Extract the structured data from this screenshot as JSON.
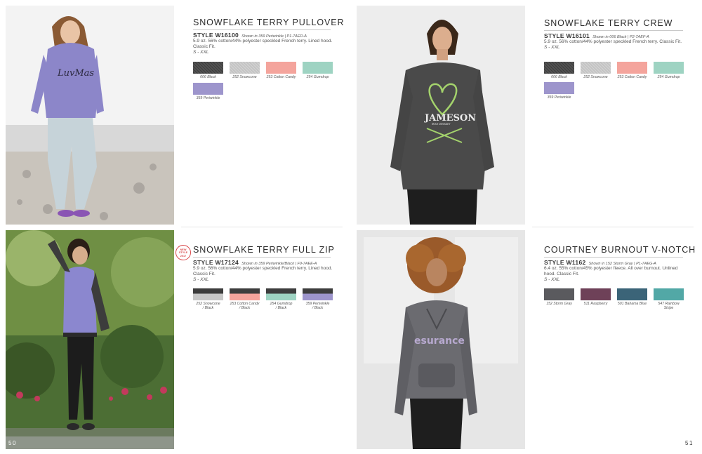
{
  "pages": {
    "left_number": "50",
    "right_number": "51"
  },
  "products": {
    "pullover": {
      "title": "SNOWFLAKE TERRY PULLOVER",
      "style_code": "STYLE W16100",
      "style_note": "Shown in 359 Periwinkle | P1-7AED-A",
      "description": "5.9 oz. 56% cotton/44% polyester speckled French terry. Lined hood. Classic Fit.",
      "sizes": "S - XXL",
      "swatches": [
        {
          "label": "006 Black",
          "color": "#4a4a4a"
        },
        {
          "label": "252 Snowcone",
          "color": "#c8c8c8"
        },
        {
          "label": "253 Cotton Candy",
          "color": "#f4a49c"
        },
        {
          "label": "254 Gumdrop",
          "color": "#9ed3c2"
        },
        {
          "label": "359 Periwinkle",
          "color": "#9d95cc"
        }
      ]
    },
    "crew": {
      "title": "SNOWFLAKE TERRY CREW",
      "style_code": "STYLE W16101",
      "style_note": "Shown in 006 Black | P2-7AEF-A",
      "description": "5.9 oz. 56% cotton/44% polyester speckled French terry. Classic Fit.",
      "sizes": "S - XXL",
      "swatches": [
        {
          "label": "006 Black",
          "color": "#4a4a4a"
        },
        {
          "label": "252 Snowcone",
          "color": "#c8c8c8"
        },
        {
          "label": "253 Cotton Candy",
          "color": "#f4a49c"
        },
        {
          "label": "254 Gumdrop",
          "color": "#9ed3c2"
        },
        {
          "label": "359 Periwinkle",
          "color": "#9d95cc"
        }
      ]
    },
    "fullzip": {
      "badge": "NEW\nSTYLE\n2017",
      "title": "SNOWFLAKE TERRY FULL ZIP",
      "style_code": "STYLE W17124",
      "style_note": "Shown in 359 Periwinkle/Black | F9-7AEE-A",
      "description": "5.9 oz. 56% cotton/44% polyester speckled French terry. Lined hood. Classic Fit.",
      "sizes": "S - XXL",
      "swatches": [
        {
          "label": "252 Snowcone\n/ Black",
          "top": "#3d3d3d",
          "color": "#c8c8c8"
        },
        {
          "label": "253 Cotton Candy\n/ Black",
          "top": "#3d3d3d",
          "color": "#f4a49c"
        },
        {
          "label": "254 Gumdrop\n/ Black",
          "top": "#3d3d3d",
          "color": "#9ed3c2"
        },
        {
          "label": "359 Periwinkle\n/ Black",
          "top": "#3d3d3d",
          "color": "#9d95cc"
        }
      ]
    },
    "vnotch": {
      "title": "COURTNEY BURNOUT V-NOTCH",
      "style_code": "STYLE W1162",
      "style_note": "Shown in 152 Storm Gray | P1-7AEG-A",
      "description": "6.4 oz. 55% cotton/45% polyester fleece. All over burnout. Unlined hood. Classic Fit.",
      "sizes": "S - XXL",
      "swatches": [
        {
          "label": "152 Storm Gray",
          "color": "#5a5a5e"
        },
        {
          "label": "511 Raspberry",
          "color": "#6e4158"
        },
        {
          "label": "501 Bahama Blue",
          "color": "#3b6478"
        },
        {
          "label": "547 Rainbow Stripe",
          "color": "#52a8a6"
        }
      ]
    }
  },
  "photos": {
    "pullover_text": "LuvMas",
    "crew_text": "JAMESON",
    "crew_subtext": "IRISH WHISKEY",
    "vnotch_text": "esurance"
  },
  "colors": {
    "badge": "#d9484a",
    "rule": "#c9c9c9"
  }
}
